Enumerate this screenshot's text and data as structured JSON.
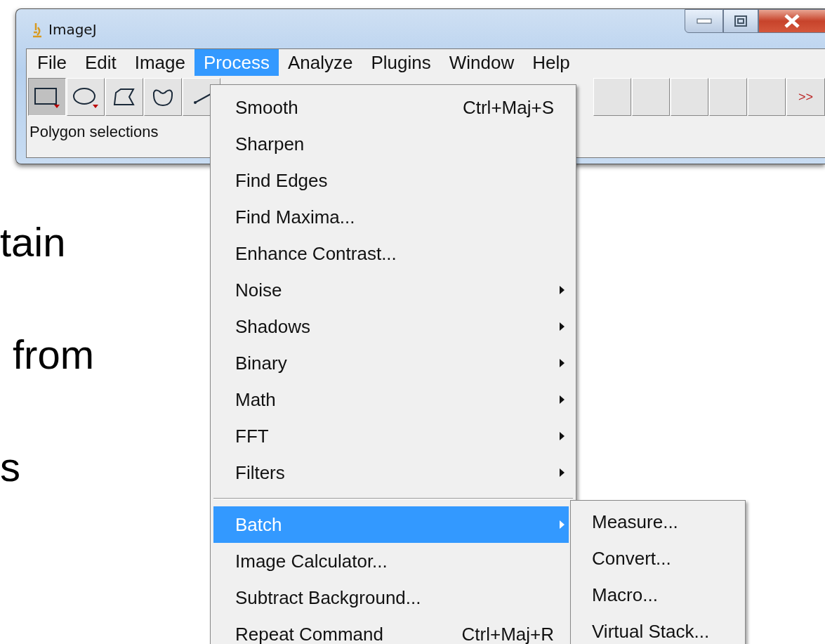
{
  "background_text": [
    "tain",
    "from",
    "s"
  ],
  "window": {
    "title": "ImageJ"
  },
  "menubar": [
    {
      "label": "File",
      "selected": false
    },
    {
      "label": "Edit",
      "selected": false
    },
    {
      "label": "Image",
      "selected": false
    },
    {
      "label": "Process",
      "selected": true
    },
    {
      "label": "Analyze",
      "selected": false
    },
    {
      "label": "Plugins",
      "selected": false
    },
    {
      "label": "Window",
      "selected": false
    },
    {
      "label": "Help",
      "selected": false
    }
  ],
  "toolbar_left": [
    {
      "kind": "rectangle",
      "selected": true
    },
    {
      "kind": "oval",
      "selected": false
    },
    {
      "kind": "polygon",
      "selected": false
    },
    {
      "kind": "freehand",
      "selected": false
    },
    {
      "kind": "line",
      "selected": false
    }
  ],
  "toolbar_right": [
    {
      "kind": "blank"
    },
    {
      "kind": "blank"
    },
    {
      "kind": "blank"
    },
    {
      "kind": "blank"
    },
    {
      "kind": "blank"
    },
    {
      "kind": "more",
      "label": ">>"
    }
  ],
  "status": "Polygon selections",
  "process_menu": [
    {
      "kind": "item",
      "label": "Smooth",
      "shortcut": "Ctrl+Maj+S",
      "submenu": false,
      "selected": false
    },
    {
      "kind": "item",
      "label": "Sharpen",
      "submenu": false,
      "selected": false
    },
    {
      "kind": "item",
      "label": "Find Edges",
      "submenu": false,
      "selected": false
    },
    {
      "kind": "item",
      "label": "Find Maxima...",
      "submenu": false,
      "selected": false
    },
    {
      "kind": "item",
      "label": "Enhance Contrast...",
      "submenu": false,
      "selected": false
    },
    {
      "kind": "item",
      "label": "Noise",
      "submenu": true,
      "selected": false
    },
    {
      "kind": "item",
      "label": "Shadows",
      "submenu": true,
      "selected": false
    },
    {
      "kind": "item",
      "label": "Binary",
      "submenu": true,
      "selected": false
    },
    {
      "kind": "item",
      "label": "Math",
      "submenu": true,
      "selected": false
    },
    {
      "kind": "item",
      "label": "FFT",
      "submenu": true,
      "selected": false
    },
    {
      "kind": "item",
      "label": "Filters",
      "submenu": true,
      "selected": false
    },
    {
      "kind": "separator"
    },
    {
      "kind": "item",
      "label": "Batch",
      "submenu": true,
      "selected": true
    },
    {
      "kind": "item",
      "label": "Image Calculator...",
      "submenu": false,
      "selected": false
    },
    {
      "kind": "item",
      "label": "Subtract Background...",
      "submenu": false,
      "selected": false
    },
    {
      "kind": "item",
      "label": "Repeat Command",
      "shortcut": "Ctrl+Maj+R",
      "submenu": false,
      "selected": false
    }
  ],
  "batch_menu": [
    {
      "label": "Measure...",
      "selected": false
    },
    {
      "label": "Convert...",
      "selected": false
    },
    {
      "label": "Macro...",
      "selected": false
    },
    {
      "label": "Virtual Stack...",
      "selected": false
    }
  ]
}
